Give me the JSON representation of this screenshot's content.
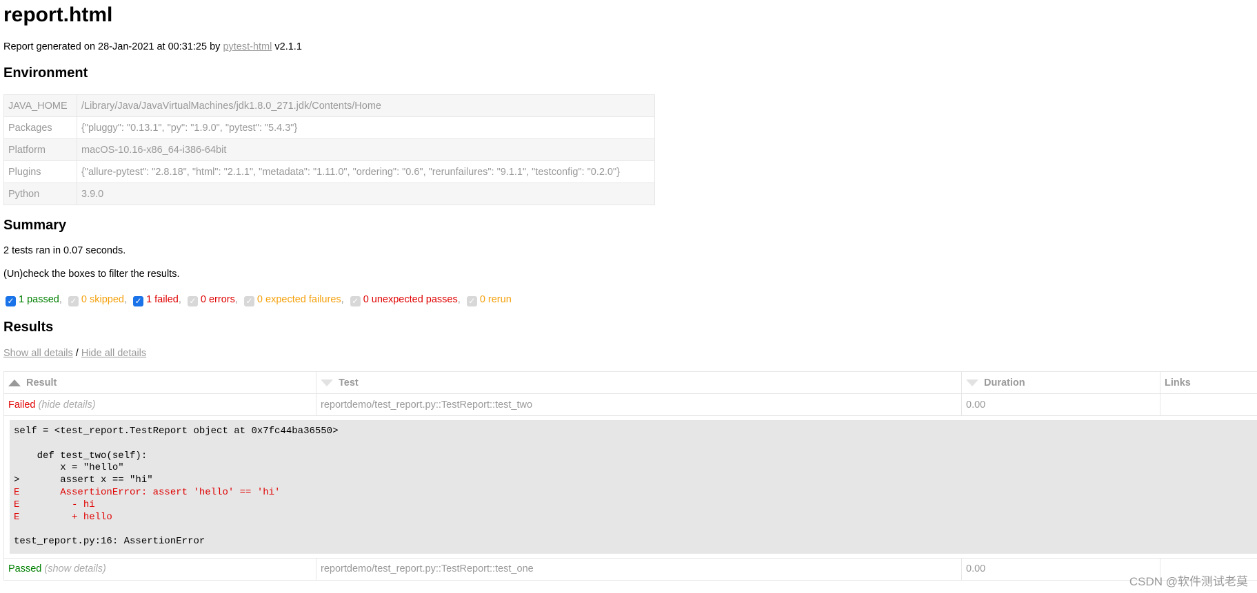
{
  "title": "report.html",
  "generated": {
    "prefix": "Report generated on 28-Jan-2021 at 00:31:25 by ",
    "link": "pytest-html",
    "suffix": " v2.1.1"
  },
  "environment": {
    "heading": "Environment",
    "rows": [
      {
        "key": "JAVA_HOME",
        "value": "/Library/Java/JavaVirtualMachines/jdk1.8.0_271.jdk/Contents/Home"
      },
      {
        "key": "Packages",
        "value": "{\"pluggy\": \"0.13.1\", \"py\": \"1.9.0\", \"pytest\": \"5.4.3\"}"
      },
      {
        "key": "Platform",
        "value": "macOS-10.16-x86_64-i386-64bit"
      },
      {
        "key": "Plugins",
        "value": "{\"allure-pytest\": \"2.8.18\", \"html\": \"2.1.1\", \"metadata\": \"1.11.0\", \"ordering\": \"0.6\", \"rerunfailures\": \"9.1.1\", \"testconfig\": \"0.2.0\"}"
      },
      {
        "key": "Python",
        "value": "3.9.0"
      }
    ]
  },
  "summary": {
    "heading": "Summary",
    "ran": "2 tests ran in 0.07 seconds.",
    "hint": "(Un)check the boxes to filter the results.",
    "filters": [
      {
        "label": "1 passed",
        "checked": true,
        "cls": "passed"
      },
      {
        "label": "0 skipped",
        "checked": false,
        "cls": "skipped"
      },
      {
        "label": "1 failed",
        "checked": true,
        "cls": "failed"
      },
      {
        "label": "0 errors",
        "checked": false,
        "cls": "errors"
      },
      {
        "label": "0 expected failures",
        "checked": false,
        "cls": "xfail"
      },
      {
        "label": "0 unexpected passes",
        "checked": false,
        "cls": "xpass"
      },
      {
        "label": "0 rerun",
        "checked": false,
        "cls": "rerun"
      }
    ]
  },
  "results": {
    "heading": "Results",
    "show_all": "Show all details",
    "separator": " / ",
    "hide_all": "Hide all details",
    "columns": {
      "result": "Result",
      "test": "Test",
      "duration": "Duration",
      "links": "Links"
    },
    "rows": [
      {
        "result": "Failed",
        "detail": "(hide details)",
        "test": "reportdemo/test_report.py::TestReport::test_two",
        "duration": "0.00",
        "log": [
          {
            "text": "self = <test_report.TestReport object at 0x7fc44ba36550>",
            "err": false
          },
          {
            "text": "",
            "err": false
          },
          {
            "text": "    def test_two(self):",
            "err": false
          },
          {
            "text": "        x = \"hello\"",
            "err": false
          },
          {
            "text": ">       assert x == \"hi\"",
            "err": false
          },
          {
            "text": "E       AssertionError: assert 'hello' == 'hi'",
            "err": true
          },
          {
            "text": "E         - hi",
            "err": true
          },
          {
            "text": "E         + hello",
            "err": true
          },
          {
            "text": "",
            "err": false
          },
          {
            "text": "test_report.py:16: AssertionError",
            "err": false
          }
        ]
      },
      {
        "result": "Passed",
        "detail": "(show details)",
        "test": "reportdemo/test_report.py::TestReport::test_one",
        "duration": "0.00"
      }
    ]
  },
  "watermark": "CSDN @软件测试老莫"
}
